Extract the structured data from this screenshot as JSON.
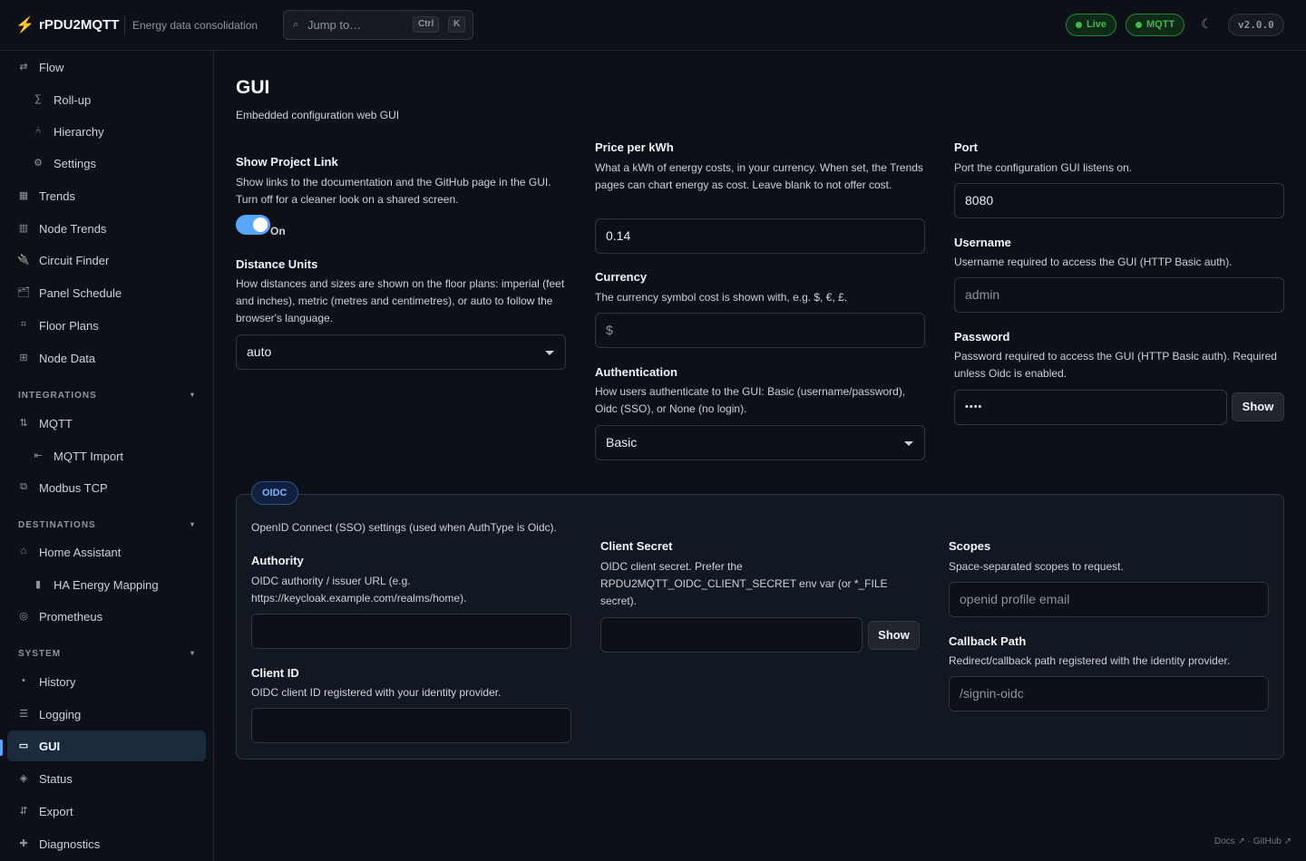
{
  "header": {
    "title": "rPDU2MQTT",
    "subtitle": "Energy data consolidation",
    "jump_placeholder": "Jump to…",
    "kbd_ctrl": "Ctrl",
    "kbd_k": "K",
    "live_label": "Live",
    "mqtt_label": "MQTT",
    "version": "v2.0.0",
    "status_color": "#3fb950"
  },
  "sidebar": {
    "flow": "Flow",
    "rollup": "Roll-up",
    "hierarchy": "Hierarchy",
    "settings": "Settings",
    "trends": "Trends",
    "node_trends": "Node Trends",
    "circuit_finder": "Circuit Finder",
    "panel_schedule": "Panel Schedule",
    "floor_plans": "Floor Plans",
    "node_data": "Node Data",
    "integrations_heading": "INTEGRATIONS",
    "mqtt": "MQTT",
    "mqtt_import": "MQTT Import",
    "modbus": "Modbus TCP",
    "destinations_heading": "DESTINATIONS",
    "home_assistant": "Home Assistant",
    "ha_energy": "HA Energy Mapping",
    "prometheus": "Prometheus",
    "system_heading": "SYSTEM",
    "history": "History",
    "logging": "Logging",
    "gui": "GUI",
    "status": "Status",
    "export": "Export",
    "diagnostics": "Diagnostics",
    "accent_color": "#58a6ff"
  },
  "page": {
    "title": "GUI",
    "subtitle": "Embedded configuration web GUI"
  },
  "fields": {
    "show_link_label": "Show Project Link",
    "show_link_desc": "Show links to the documentation and the GitHub page in the GUI. Turn off for a cleaner look on a shared screen.",
    "show_link_state": "On",
    "distance_label": "Distance Units",
    "distance_desc": "How distances and sizes are shown on the floor plans: imperial (feet and inches), metric (metres and centimetres), or auto to follow the browser's language.",
    "distance_value": "auto",
    "price_label": "Price per kWh",
    "price_desc": "What a kWh of energy costs, in your currency. When set, the Trends pages can chart energy as cost. Leave blank to not offer cost.",
    "price_value": "0.14",
    "currency_label": "Currency",
    "currency_desc": "The currency symbol cost is shown with, e.g. $, €, £.",
    "currency_placeholder": "$",
    "auth_label": "Authentication",
    "auth_desc": "How users authenticate to the GUI: Basic (username/password), Oidc (SSO), or None (no login).",
    "auth_value": "Basic",
    "port_label": "Port",
    "port_desc": "Port the configuration GUI listens on.",
    "port_value": "8080",
    "username_label": "Username",
    "username_desc": "Username required to access the GUI (HTTP Basic auth).",
    "username_placeholder": "admin",
    "password_label": "Password",
    "password_desc": "Password required to access the GUI (HTTP Basic auth). Required unless Oidc is enabled.",
    "password_value": "••••",
    "password_show": "Show"
  },
  "oidc": {
    "badge": "OIDC",
    "desc": "OpenID Connect (SSO) settings (used when AuthType is Oidc).",
    "authority_label": "Authority",
    "authority_desc": "OIDC authority / issuer URL (e.g. https://keycloak.example.com/realms/home).",
    "authority_value": "",
    "client_id_label": "Client ID",
    "client_id_desc": "OIDC client ID registered with your identity provider.",
    "client_id_value": "",
    "secret_label": "Client Secret",
    "secret_desc": "OIDC client secret. Prefer the RPDU2MQTT_OIDC_CLIENT_SECRET env var (or *_FILE secret).",
    "secret_value": "",
    "secret_show": "Show",
    "scopes_label": "Scopes",
    "scopes_desc": "Space-separated scopes to request.",
    "scopes_placeholder": "openid profile email",
    "callback_label": "Callback Path",
    "callback_desc": "Redirect/callback path registered with the identity provider.",
    "callback_placeholder": "/signin-oidc"
  },
  "footer": {
    "links": "Docs ↗ · GitHub ↗"
  }
}
